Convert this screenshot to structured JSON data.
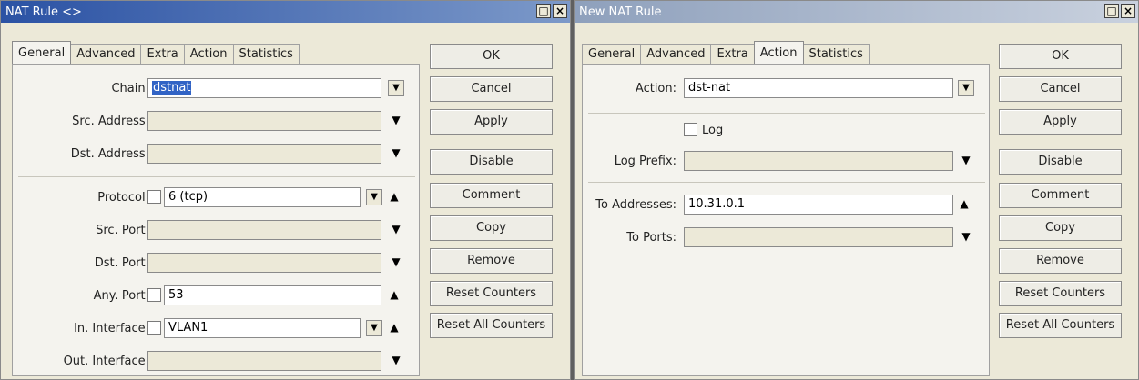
{
  "left_window": {
    "title": "NAT Rule <>",
    "tabs": [
      "General",
      "Advanced",
      "Extra",
      "Action",
      "Statistics"
    ],
    "active_tab": "General",
    "fields": {
      "chain": {
        "label": "Chain:",
        "value": "dstnat"
      },
      "src_address": {
        "label": "Src. Address:",
        "value": ""
      },
      "dst_address": {
        "label": "Dst. Address:",
        "value": ""
      },
      "protocol": {
        "label": "Protocol:",
        "value": "6 (tcp)"
      },
      "src_port": {
        "label": "Src. Port:",
        "value": ""
      },
      "dst_port": {
        "label": "Dst. Port:",
        "value": ""
      },
      "any_port": {
        "label": "Any. Port:",
        "value": "53"
      },
      "in_interface": {
        "label": "In. Interface:",
        "value": "VLAN1"
      },
      "out_interface": {
        "label": "Out. Interface:",
        "value": ""
      }
    },
    "buttons": [
      "OK",
      "Cancel",
      "Apply",
      "Disable",
      "Comment",
      "Copy",
      "Remove",
      "Reset Counters",
      "Reset All Counters"
    ]
  },
  "right_window": {
    "title": "New NAT Rule",
    "tabs": [
      "General",
      "Advanced",
      "Extra",
      "Action",
      "Statistics"
    ],
    "active_tab": "Action",
    "fields": {
      "action": {
        "label": "Action:",
        "value": "dst-nat"
      },
      "log": {
        "label": "Log"
      },
      "log_prefix": {
        "label": "Log Prefix:",
        "value": ""
      },
      "to_addresses": {
        "label": "To Addresses:",
        "value": "10.31.0.1"
      },
      "to_ports": {
        "label": "To Ports:",
        "value": ""
      }
    },
    "buttons": [
      "OK",
      "Cancel",
      "Apply",
      "Disable",
      "Comment",
      "Copy",
      "Remove",
      "Reset Counters",
      "Reset All Counters"
    ]
  },
  "icons": {
    "dropdown": "▼",
    "expand": "▲",
    "select_list": "combo-select-icon",
    "minimize": "□",
    "close": "×"
  }
}
